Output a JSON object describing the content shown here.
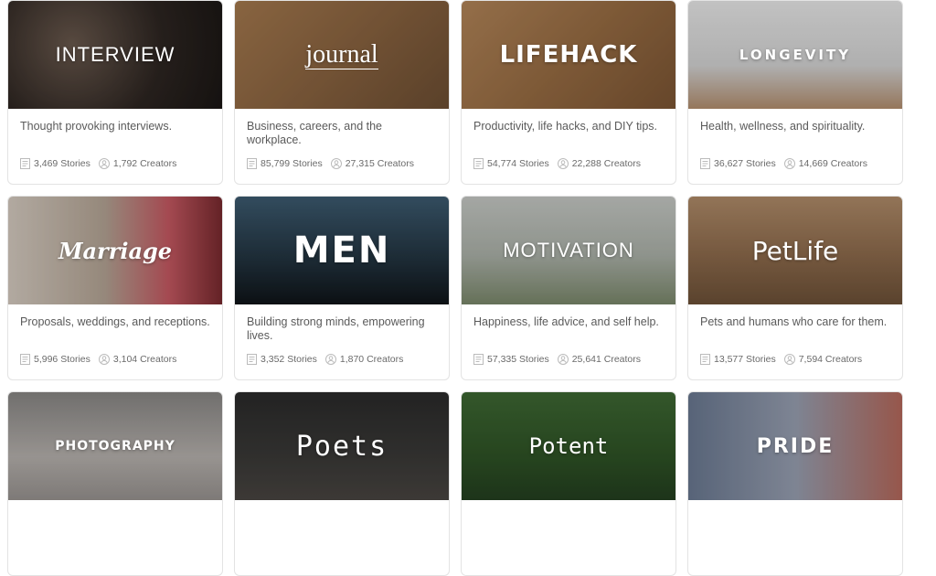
{
  "cards": [
    {
      "title": "INTERVIEW",
      "description": "Thought provoking interviews.",
      "stories": "3,469 Stories",
      "creators": "1,792 Creators"
    },
    {
      "title": "journal",
      "description": "Business, careers, and the workplace.",
      "stories": "85,799 Stories",
      "creators": "27,315 Creators"
    },
    {
      "title": "LIFEHACK",
      "description": "Productivity, life hacks, and DIY tips.",
      "stories": "54,774 Stories",
      "creators": "22,288 Creators"
    },
    {
      "title": "LONGEVITY",
      "description": "Health, wellness, and spirituality.",
      "stories": "36,627 Stories",
      "creators": "14,669 Creators"
    },
    {
      "title": "Marriage",
      "description": "Proposals, weddings, and receptions.",
      "stories": "5,996 Stories",
      "creators": "3,104 Creators"
    },
    {
      "title": "MEN",
      "description": "Building strong minds, empowering lives.",
      "stories": "3,352 Stories",
      "creators": "1,870 Creators"
    },
    {
      "title": "MOTIVATION",
      "description": "Happiness, life advice, and self help.",
      "stories": "57,335 Stories",
      "creators": "25,641 Creators"
    },
    {
      "title": "PetLife",
      "description": "Pets and humans who care for them.",
      "stories": "13,577 Stories",
      "creators": "7,594 Creators"
    },
    {
      "title": "PHOTOGRAPHY",
      "description": "",
      "stories": "",
      "creators": ""
    },
    {
      "title": "Poets",
      "description": "",
      "stories": "",
      "creators": ""
    },
    {
      "title": "Potent",
      "description": "",
      "stories": "",
      "creators": ""
    },
    {
      "title": "PRIDE",
      "description": "",
      "stories": "",
      "creators": ""
    }
  ]
}
